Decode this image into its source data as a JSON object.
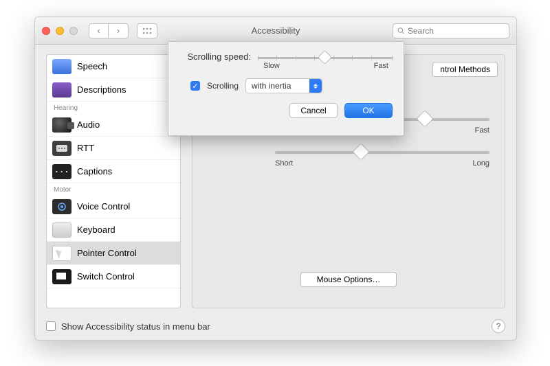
{
  "window": {
    "title": "Accessibility",
    "search_placeholder": "Search"
  },
  "sidebar": {
    "categories": {
      "hearing": "Hearing",
      "motor": "Motor"
    },
    "items": [
      {
        "label": "Speech"
      },
      {
        "label": "Descriptions"
      },
      {
        "label": "Audio"
      },
      {
        "label": "RTT"
      },
      {
        "label": "Captions"
      },
      {
        "label": "Voice Control"
      },
      {
        "label": "Keyboard"
      },
      {
        "label": "Pointer Control"
      },
      {
        "label": "Switch Control"
      }
    ]
  },
  "main": {
    "tab_methods_suffix": "ntrol Methods",
    "slider1": {
      "right": "Fast",
      "value_pct": 70
    },
    "slider2": {
      "left": "Short",
      "right": "Long",
      "value_pct": 40
    },
    "mouse_options": "Mouse Options…"
  },
  "sheet": {
    "scrolling_speed_label": "Scrolling speed:",
    "slow": "Slow",
    "fast": "Fast",
    "speed_value_pct": 50,
    "scrolling_checkbox_label": "Scrolling",
    "scrolling_checked": true,
    "inertia_select": "with inertia",
    "cancel": "Cancel",
    "ok": "OK"
  },
  "footer": {
    "show_status": "Show Accessibility status in menu bar",
    "help": "?"
  }
}
